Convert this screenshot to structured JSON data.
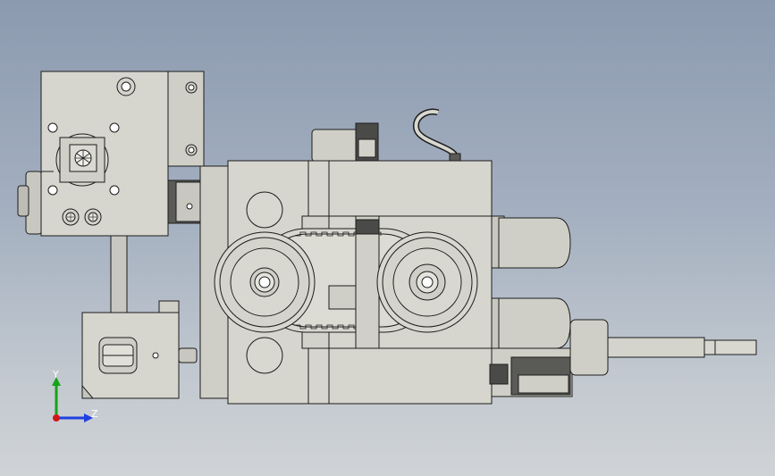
{
  "viewport": {
    "colors": {
      "background_top": "#8c9ab0",
      "background_bottom": "#d0d3d6",
      "part_fill": "#d4d4cc",
      "part_shadow": "#b8b8b0",
      "edge": "#1c1c1c",
      "dark_part": "#4a4a48"
    }
  },
  "triad": {
    "y_label": "Y",
    "z_label": "Z",
    "colors": {
      "y": "#16a316",
      "z": "#2040e0",
      "x": "#d01818"
    }
  }
}
